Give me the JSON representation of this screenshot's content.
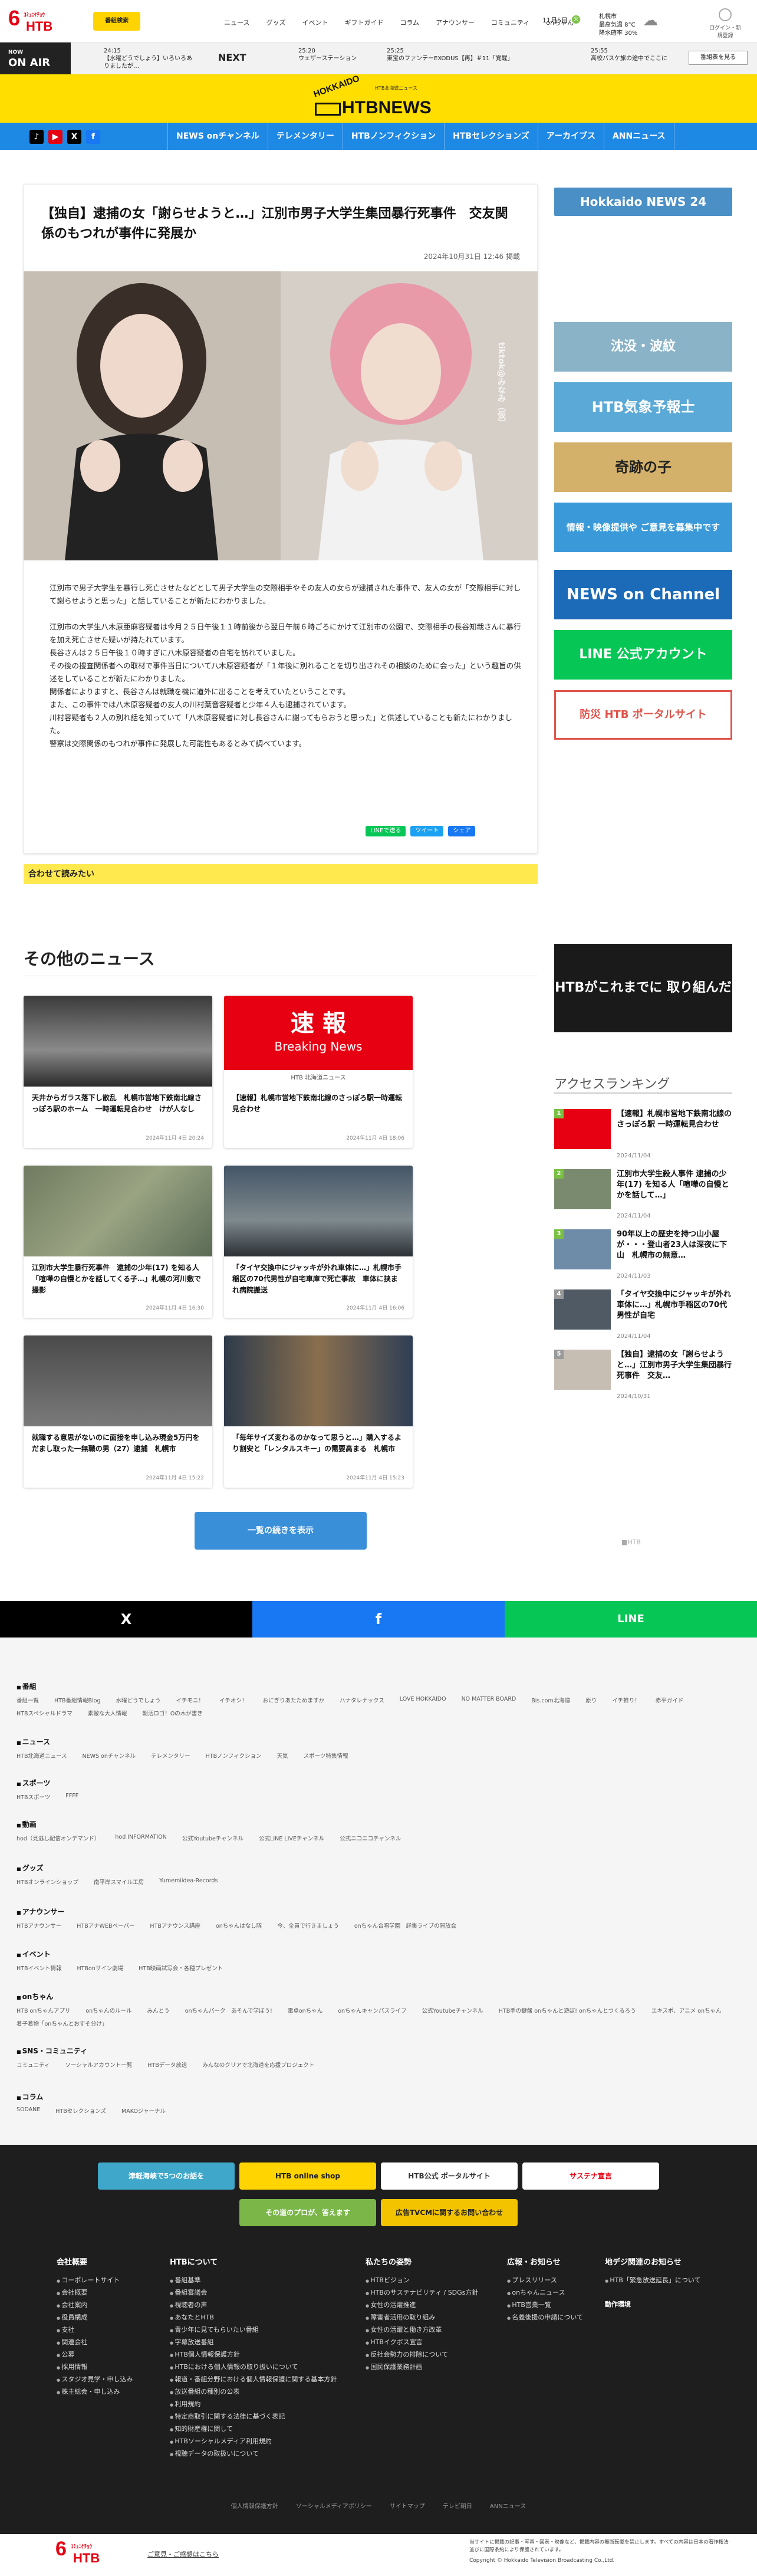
{
  "header": {
    "logo_six": "6",
    "logo_sub": "ｺﾐｭﾆｹﾁｮｳ",
    "logo_htb": "HTB",
    "bookmark": "番組検索",
    "nav": [
      "ニュース",
      "グッズ",
      "イベント",
      "ギフトガイド",
      "コラム",
      "アナウンサー",
      "コミュニティ",
      "onちゃん"
    ],
    "date": "11月5日",
    "date_badge": "火",
    "weather_city": "札幌市",
    "weather_temp": "最高気温 8°C",
    "weather_rain": "降水確率 30%",
    "login": "ログイン・新規登録"
  },
  "onair": {
    "label": "NOW",
    "label2": "ON AIR",
    "now_time": "24:15",
    "now_title": "【水曜どうでしょう】いろいろありましたが…",
    "next_label": "NEXT",
    "next1_time": "25:20",
    "next1_title": "ウェザーステーション",
    "next2_time": "25:25",
    "next2_title": "東宝のファンテーEXODUS【再】＃11「覚醒」",
    "next3_time": "25:55",
    "next3_title": "高校バスケ旅の途中でここに",
    "tvguide": "番組表を見る"
  },
  "brand": {
    "hokkaido": "HOKKAIDO",
    "tiny": "HTB北海道ニュース",
    "htbnews": "HTBNEWS"
  },
  "social": [
    "♪",
    "▶",
    "X",
    "f"
  ],
  "navlinks": [
    "NEWS onチャンネル",
    "テレメンタリー",
    "HTBノンフィクション",
    "HTBセレクションズ",
    "アーカイブス",
    "ANNニュース"
  ],
  "article": {
    "title": "【独自】逮捕の女「謝らせようと…」江別市男子大学生集団暴行死事件　交友関係のもつれが事件に発展か",
    "date": "2024年10月31日 12:46 掲載",
    "img_watermark": "tiktok@みなみ（仮）",
    "paragraphs": [
      "江別市で男子大学生を暴行し死亡させたなどとして男子大学生の交際相手やその友人の女らが逮捕された事件で、友人の女が「交際相手に対して謝らせようと思った」と話していることが新たにわかりました。",
      "",
      "江別市の大学生八木原亜麻容疑者は今月２５日午後１１時前後から翌日午前６時ごろにかけて江別市の公園で、交際相手の長谷知哉さんに暴行を加え死亡させた疑いが持たれています。",
      "長谷さんは２５日午後１０時すぎに八木原容疑者の自宅を訪れていました。",
      "その後の捜査関係者への取材で事件当日について八木原容疑者が「１年後に別れることを切り出されその相談のために会った」という趣旨の供述をしていることが新たにわかりました。",
      "関係者によりますと、長谷さんは就職を機に道外に出ることを考えていたということです。",
      "また、この事件では八木原容疑者の友人の川村葉音容疑者と少年４人も逮捕されています。",
      "川村容疑者も２人の別れ話を知っていて「八木原容疑者に対し長谷さんに謝ってもらおうと思った」と供述していることも新たにわかりました。",
      "警察は交際関係のもつれが事件に発展した可能性もあるとみて調べています。"
    ],
    "share_line": "LINEで送る",
    "share_tweet": "ツイート",
    "share_fb": "シェア",
    "related": "合わせて読みたい"
  },
  "sidebar": {
    "banners": [
      {
        "label": "Hokkaido NEWS 24",
        "color": "#4a90c6"
      },
      {
        "label": "沈没・波紋",
        "color": "#8ab3c8"
      },
      {
        "label": "HTB気象予報士",
        "color": "#5aa9d6"
      },
      {
        "label": "奇跡の子",
        "color": "#d4b16a"
      },
      {
        "label": "情報・映像提供や ご意見を募集中です",
        "color": "#3a9ad9"
      },
      {
        "label": "NEWS on Channel",
        "color": "#1b6bb8"
      },
      {
        "label": "LINE 公式アカウント",
        "color": "#06c755"
      },
      {
        "label": "防災 HTB ポータルサイト",
        "color": "#e0534a"
      },
      {
        "label": "HTBがこれまでに 取り組んだ企画です。",
        "color": "#1a1a1a"
      }
    ],
    "ranking_title": "アクセスランキング",
    "ranking": [
      {
        "num": "1",
        "title": "【速報】札幌市営地下鉄南北線のさっぽろ駅 一時運転見合わせ",
        "date": "2024/11/04"
      },
      {
        "num": "2",
        "title": "江別市大学生殺人事件 逮捕の少年(17) を知る人「喧嘩の自慢とかを話して…」",
        "date": "2024/11/04"
      },
      {
        "num": "3",
        "title": "90年以上の歴史を持つ山小屋が・・・登山者23人は深夜に下山　札幌市の無意…",
        "date": "2024/11/03"
      },
      {
        "num": "4",
        "title": "「タイヤ交換中にジャッキが外れ車体に…」札幌市手稲区の70代男性が自宅",
        "date": "2024/11/04"
      },
      {
        "num": "5",
        "title": "【独自】逮捕の女「謝らせようと…」江別市男子大学生集団暴行死事件　交友…",
        "date": "2024/10/31"
      }
    ],
    "sidelogo": "■HTB"
  },
  "other": {
    "title": "その他のニュース",
    "cards": [
      {
        "title": "天井からガラス落下し散乱　札幌市営地下鉄南北線さっぽろ駅のホーム　一時運転見合わせ　けが人なし",
        "date": "2024年11月 4日 20:24"
      },
      {
        "title": "【速報】札幌市営地下鉄南北線のさっぽろ駅一時運転見合わせ",
        "date": "2024年11月 4日 18:06"
      },
      {
        "title": "江別市大学生暴行死事件　逮捕の少年(17) を知る人「喧嘩の自慢とかを話してくる子…」札幌の河川敷で撮影",
        "date": "2024年11月 4日 16:30"
      },
      {
        "title": "「タイヤ交換中にジャッキが外れ車体に…」札幌市手稲区の70代男性が自宅車庫で死亡事故　車体に挟まれ病院搬送",
        "date": "2024年11月 4日 16:06"
      },
      {
        "title": "就職する意思がないのに面接を申し込み現金5万円をだまし取った一無職の男（27）逮捕　札幌市",
        "date": "2024年11月 4日 15:22"
      },
      {
        "title": "「毎年サイズ変わるのかなって思うと…」購入するより割安と「レンタルスキー」の需要高まる　札幌市",
        "date": "2024年11月 4日 15:23"
      }
    ],
    "sokuho": "速 報",
    "breaking": "Breaking News",
    "breaking_sub": "HTB 北海道ニュース",
    "more": "一覧の続きを表示"
  },
  "sharebar": {
    "x": "X",
    "fb": "f",
    "line": "LINE"
  },
  "sitemap": [
    {
      "h": "番組",
      "items": [
        "番組一覧",
        "HTB番組情報Blog",
        "水曜どうでしょう",
        "イチモニ！",
        "イチオシ！",
        "おにぎりあたためますか",
        "ハナタレナックス",
        "LOVE HOKKAIDO",
        "NO MATTER BOARD",
        "Bis.com北海道",
        "原り",
        "イチ推り！",
        "赤平ガイド",
        "HTBスペシャルドラマ",
        "素敵な大人情報",
        "朝活ロゴ！Oの木が書き"
      ]
    },
    {
      "h": "ニュース",
      "items": [
        "HTB北海道ニュース",
        "NEWS onチャンネル",
        "テレメンタリー",
        "HTBノンフィクション",
        "天気",
        "スポーツ特集情報"
      ]
    },
    {
      "h": "スポーツ",
      "items": [
        "HTBスポーツ",
        "FFFF"
      ]
    },
    {
      "h": "動画",
      "items": [
        "hod（見逃し配信オンデマンド）",
        "hod INFORMATION",
        "公式Youtubeチャンネル",
        "公式LINE LIVEチャンネル",
        "公式ニコニコチャンネル"
      ]
    },
    {
      "h": "グッズ",
      "items": [
        "HTBオンラインショップ",
        "南平岸スマイル工房",
        "Yumemiidea-Records"
      ]
    },
    {
      "h": "アナウンサー",
      "items": [
        "HTBアナウンサー",
        "HTBアナWEBペーパー",
        "HTBアナウンス講座",
        "onちゃんはなし隊",
        "今、全員で行きましょう",
        "onちゃん合唱学園　詳集ライブの開放会"
      ]
    },
    {
      "h": "イベント",
      "items": [
        "HTBイベント情報",
        "HTBonサイン劇場",
        "HTB映画試写会・各種プレゼント"
      ]
    },
    {
      "h": "onちゃん",
      "items": [
        "HTB onちゃんアプリ",
        "onちゃんのルール",
        "みんとう",
        "onちゃんパーク　あそんで学ぼう!",
        "電卓onちゃん",
        "onちゃんキャンパスライフ",
        "公式Youtubeチャンネル",
        "HTB手の鍵盤 onちゃんと遊ぼ! onちゃんとつくるろう",
        "エキスポ、アニメ onちゃん",
        "着子着物「onちゃんとおすそ分け」"
      ]
    },
    {
      "h": "SNS・コミュニティ",
      "items": [
        "コミュニティ",
        "ソーシャルアカウント一覧",
        "HTBデータ放送",
        "みんなのクリアで北海道を応援プロジェクト"
      ]
    },
    {
      "h": "コラム",
      "items": [
        "SODANE",
        "HTBセレクションズ",
        "MAKOジャーナル"
      ]
    }
  ],
  "footer": {
    "banners": [
      {
        "label": "津軽海峡で5つのお話を",
        "color": "#3fa7c9"
      },
      {
        "label": "HTB online shop",
        "color": "#ffd400"
      },
      {
        "label": "HTB公式 ポータルサイト",
        "color": "#ffffff"
      },
      {
        "label": "サステナ宣言",
        "color": "#ffffff"
      },
      {
        "label": "その道のプロが、答えます",
        "color": "#7ab648"
      },
      {
        "label": "広告TVCMに関するお問い合わせ",
        "color": "#f4c300"
      }
    ],
    "cols": [
      {
        "h": "会社概要",
        "items": [
          "コーポレートサイト",
          "会社概要",
          "会社案内",
          "役員構成",
          "支社",
          "関連会社",
          "公募",
          "採用情報",
          "スタジオ見学・申し込み",
          "株主総会・申し込み"
        ]
      },
      {
        "h": "HTBについて",
        "items": [
          "番組基準",
          "番組審議会",
          "視聴者の声",
          "あなたとHTB",
          "青少年に見てもらいたい番組",
          "字幕放送番組",
          "HTB個人情報保護方針",
          "HTBにおける個人情報の取り扱いについて",
          "報道・番組分野における個人情報保護に関する基本方針",
          "放送番組の種別の公表",
          "利用規約",
          "特定商取引に関する法律に基づく表記",
          "知的財産権に関して",
          "HTBソーシャルメディア利用規約",
          "視聴データの取扱いについて"
        ]
      },
      {
        "h": "私たちの姿勢",
        "items": [
          "HTBビジョン",
          "HTBのサステナビリティ / SDGs方針",
          "女性の活躍推進",
          "障害者活用の取り組み",
          "女性の活躍と働き方改革",
          "HTBイクボス宣言",
          "反社会勢力の排除について",
          "国民保護業務計画"
        ]
      },
      {
        "h": "広報・お知らせ",
        "items": [
          "プレスリリース",
          "onちゃんニュース",
          "HTB営業一覧",
          "名義後援の申請について"
        ]
      },
      {
        "h": "地デジ関連のお知らせ",
        "items": [
          "HTB「緊急放送延長」について",
          "",
          "動作環境",
          "",
          "",
          ""
        ]
      }
    ],
    "bottom": [
      "個人情報保護方針",
      "ソーシャルメディアポリシー",
      "サイトマップ",
      "テレビ朝日",
      "ANNニュース"
    ],
    "copyright": "Copyright © Hokkaido Television Broadcasting Co.,Ltd.",
    "copy_note": "当サイトに掲載の記事・写真・図表・映像など、掲載内容の無断転載を禁止します。すべての内容は日本の著作権法並びに国際条約により保護されています。",
    "footer_link": "ご意見・ご感想はこちら"
  }
}
